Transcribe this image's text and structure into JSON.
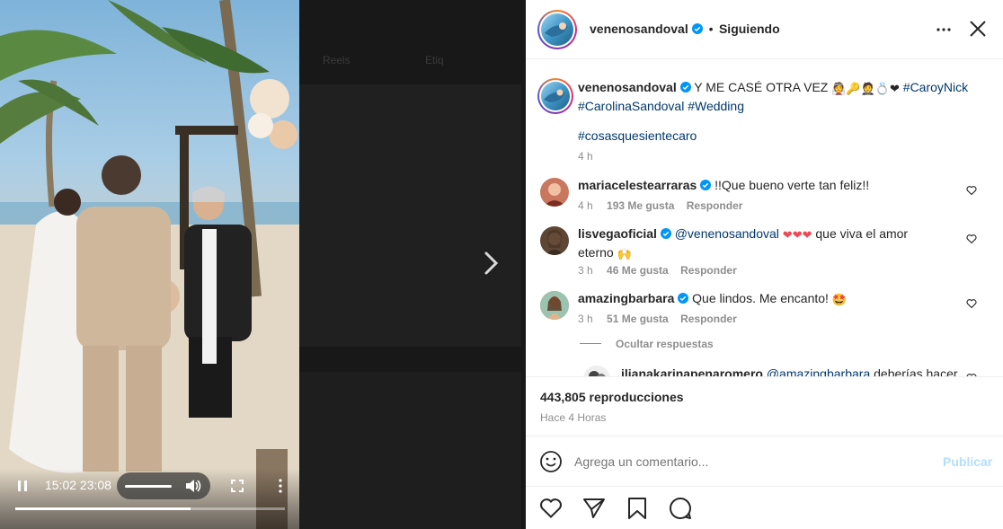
{
  "background": {
    "tabs": [
      "Reels",
      "Etiq"
    ]
  },
  "video": {
    "time_display": "15:02 23:08",
    "progress_fraction": 0.65,
    "volume_fraction": 0.5,
    "icons": [
      "pause-icon",
      "volume-icon",
      "fullscreen-icon",
      "more-vertical-icon"
    ]
  },
  "header": {
    "username": "venenosandoval",
    "separator": "•",
    "follow_status": "Siguiendo",
    "icons": [
      "more-horizontal-icon",
      "close-icon",
      "verified-icon"
    ]
  },
  "caption": {
    "username": "venenosandoval",
    "text": "Y ME CASÉ OTRA VEZ",
    "emojis": "👰🔑🤵💍❤",
    "hashtags_line1": "#CaroyNick",
    "hashtags_line2": "#CarolinaSandoval #Wedding",
    "hashtag_extra": "#cosasquesientecaro",
    "time": "4 h"
  },
  "comments": [
    {
      "username": "mariacelestearraras",
      "text": "!!Que bueno verte tan feliz!!",
      "time": "4 h",
      "likes": "193 Me gusta",
      "reply": "Responder"
    },
    {
      "username": "lisvegaoficial",
      "mention": "@venenosandoval",
      "hearts": "❤❤❤",
      "text_line1": "que viva el amor",
      "text_line2": "eterno",
      "emoji": "🙌",
      "time": "3 h",
      "likes": "46 Me gusta",
      "reply": "Responder"
    },
    {
      "username": "amazingbarbara",
      "text": "Que lindos. Me encanto!",
      "emoji": "🤩",
      "time": "3 h",
      "likes": "51 Me gusta",
      "reply": "Responder"
    }
  ],
  "hide_replies": "Ocultar respuestas",
  "reply_preview": {
    "username": "ilianakarinapenaromero",
    "mention": "@amazingbarbara",
    "text": "deberías hacer"
  },
  "stats": {
    "views": "443,805 reproducciones",
    "posted": "Hace 4 Horas"
  },
  "add_comment": {
    "placeholder": "Agrega un comentario...",
    "publish": "Publicar"
  },
  "colors": {
    "verified": "#0095f6",
    "link": "#00376b",
    "publish_disabled": "#b2dffc",
    "heart_red": "#ed4956"
  }
}
